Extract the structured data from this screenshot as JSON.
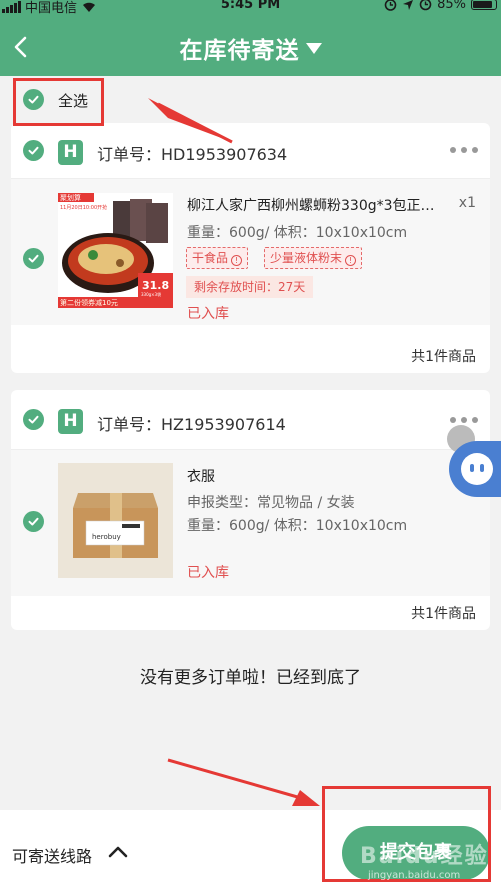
{
  "status_bar": {
    "carrier": "中国电信",
    "time": "5:45 PM",
    "battery": "85%"
  },
  "nav": {
    "title": "在库待寄送"
  },
  "select_all": {
    "label": "全选"
  },
  "orders": [
    {
      "order_label": "订单号：",
      "order_no": "HD1953907634",
      "product": {
        "title": "柳江人家广西柳州螺蛳粉330g*3包正…",
        "qty": "x1",
        "spec": "重量：600g/ 体积：10x10x10cm",
        "tags": [
          "干食品",
          "少量液体粉末"
        ],
        "storage": "剩余存放时间：27天",
        "status": "已入库",
        "image_texts": {
          "banner": "聚划算",
          "date": "11月20日10:00开抢",
          "price": "31.8",
          "weight": "330g×3袋",
          "promo": "第二份领券减10元"
        }
      },
      "footer": "共1件商品"
    },
    {
      "order_label": "订单号：",
      "order_no": "HZ1953907614",
      "product": {
        "title": "衣服",
        "declare": "申报类型：常见物品 / 女装",
        "spec": "重量：600g/ 体积：10x10x10cm",
        "status": "已入库",
        "image_texts": {
          "brand": "herobuy"
        }
      },
      "footer": "共1件商品"
    }
  ],
  "end_message": "没有更多订单啦！已经到底了",
  "bottom": {
    "route_label": "可寄送线路",
    "submit_label": "提交包裹"
  },
  "watermark": {
    "text": "Baidu经验",
    "url": "jingyan.baidu.com"
  },
  "colors": {
    "primary": "#52ad7f",
    "alert": "#e05050",
    "annotation": "#e53935"
  }
}
